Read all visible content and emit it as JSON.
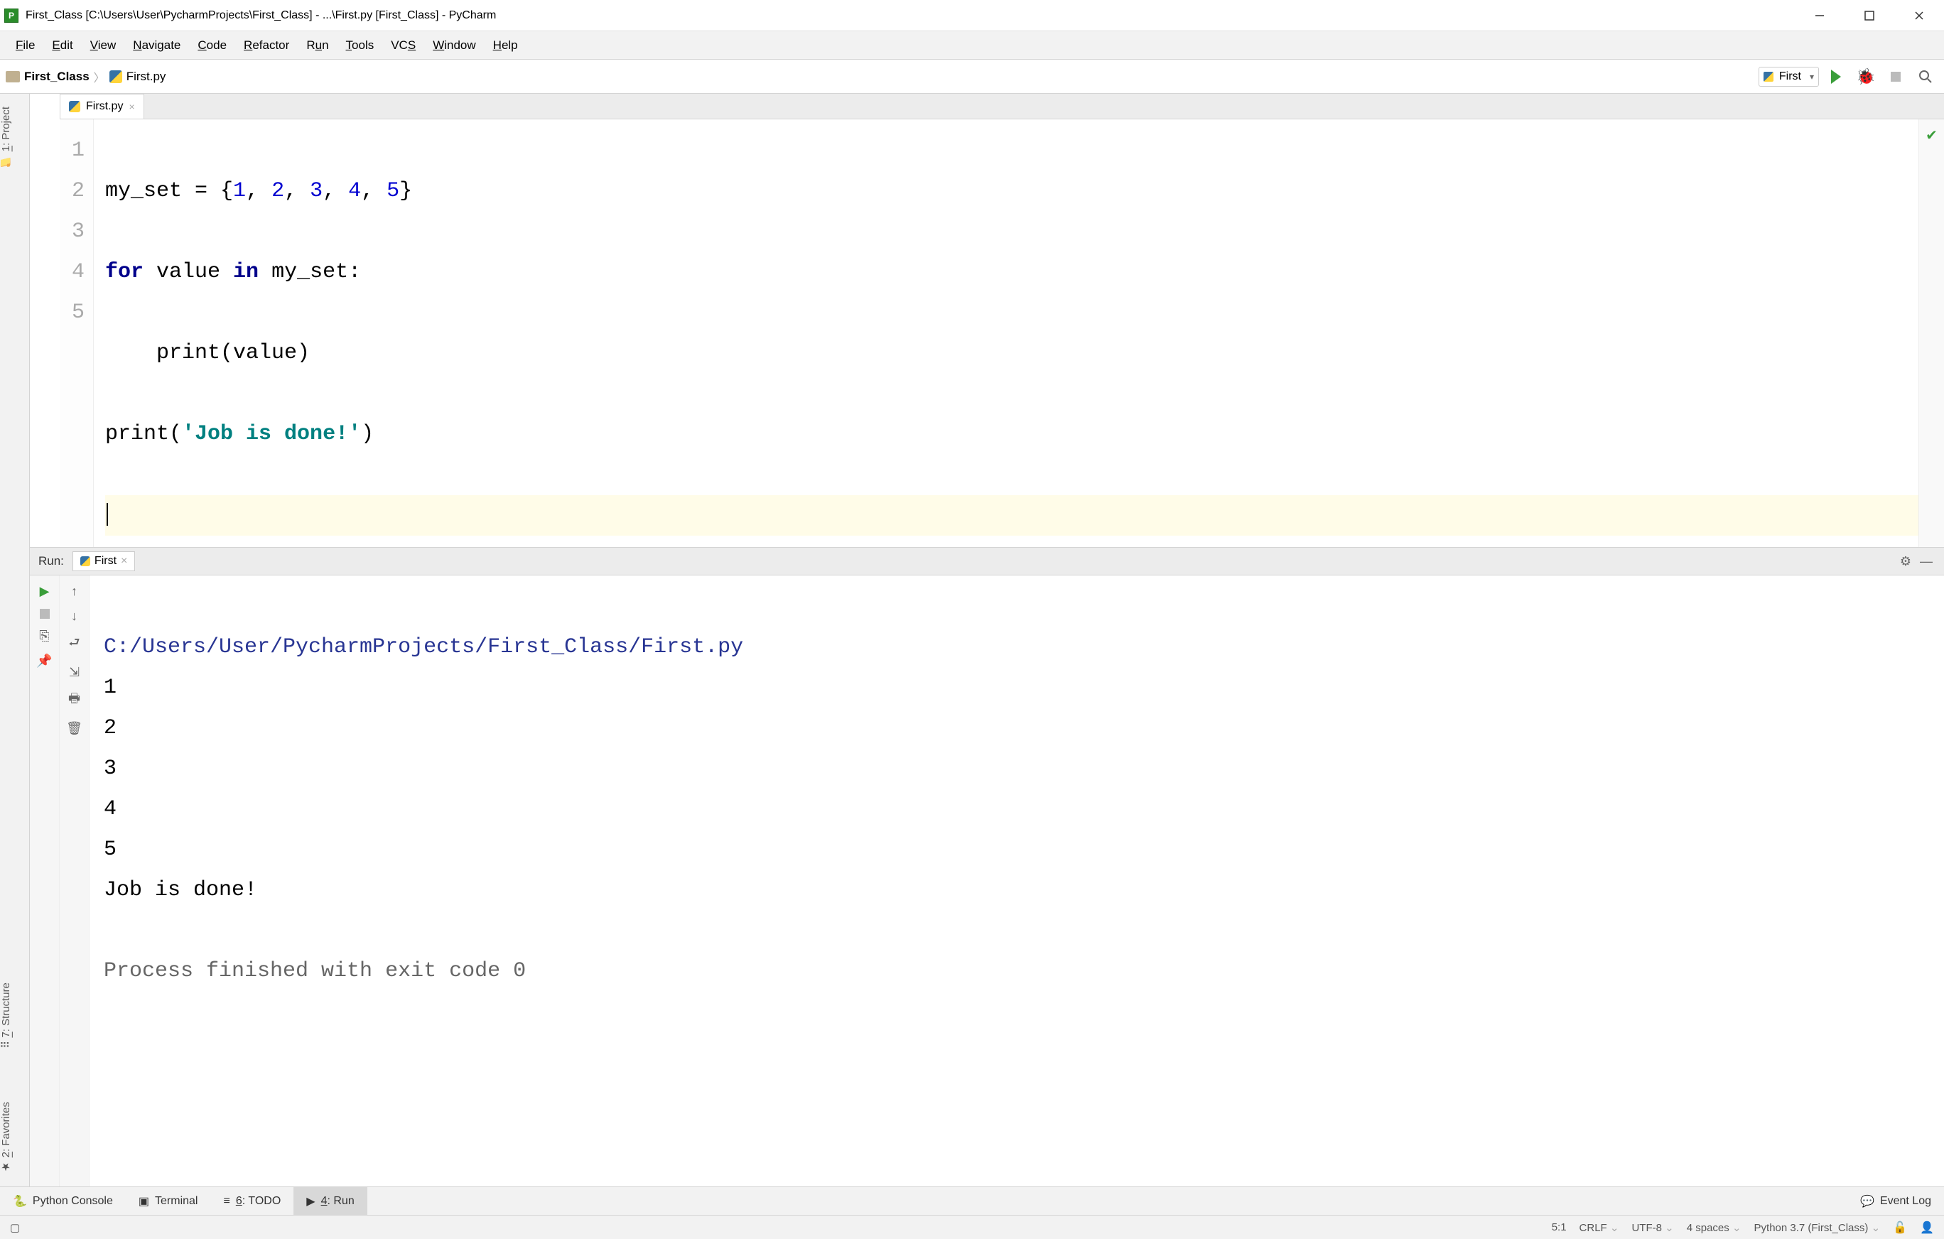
{
  "window": {
    "title": "First_Class [C:\\Users\\User\\PycharmProjects\\First_Class] - ...\\First.py [First_Class] - PyCharm"
  },
  "menu": {
    "file": "File",
    "edit": "Edit",
    "view": "View",
    "navigate": "Navigate",
    "code": "Code",
    "refactor": "Refactor",
    "run": "Run",
    "tools": "Tools",
    "vcs": "VCS",
    "window": "Window",
    "help": "Help"
  },
  "breadcrumb": {
    "project": "First_Class",
    "file": "First.py"
  },
  "run_config": {
    "selected": "First"
  },
  "editor": {
    "tab_name": "First.py",
    "line_numbers": [
      "1",
      "2",
      "3",
      "4",
      "5"
    ],
    "code": {
      "line1_pre": "my_set = {",
      "line1_nums": [
        "1",
        "2",
        "3",
        "4",
        "5"
      ],
      "line1_sep": ", ",
      "line1_post": "}",
      "line2_for": "for",
      "line2_mid": " value ",
      "line2_in": "in",
      "line2_end": " my_set:",
      "line3": "    print(value)",
      "line4_pre": "print(",
      "line4_str": "'Job is done!'",
      "line4_post": ")"
    }
  },
  "side_tabs": {
    "project": "1: Project",
    "structure": "7: Structure",
    "favorites": "2: Favorites"
  },
  "run_panel": {
    "label": "Run:",
    "tab": "First",
    "console": {
      "path": "C:/Users/User/PycharmProjects/First_Class/First.py",
      "output": [
        "1",
        "2",
        "3",
        "4",
        "5",
        "Job is done!"
      ],
      "exit": "Process finished with exit code 0"
    }
  },
  "bottom_bar": {
    "python_console": "Python Console",
    "terminal": "Terminal",
    "todo": "6: TODO",
    "run": "4: Run",
    "event_log": "Event Log"
  },
  "status": {
    "pos": "5:1",
    "line_ending": "CRLF",
    "encoding": "UTF-8",
    "indent": "4 spaces",
    "interpreter": "Python 3.7 (First_Class)"
  }
}
